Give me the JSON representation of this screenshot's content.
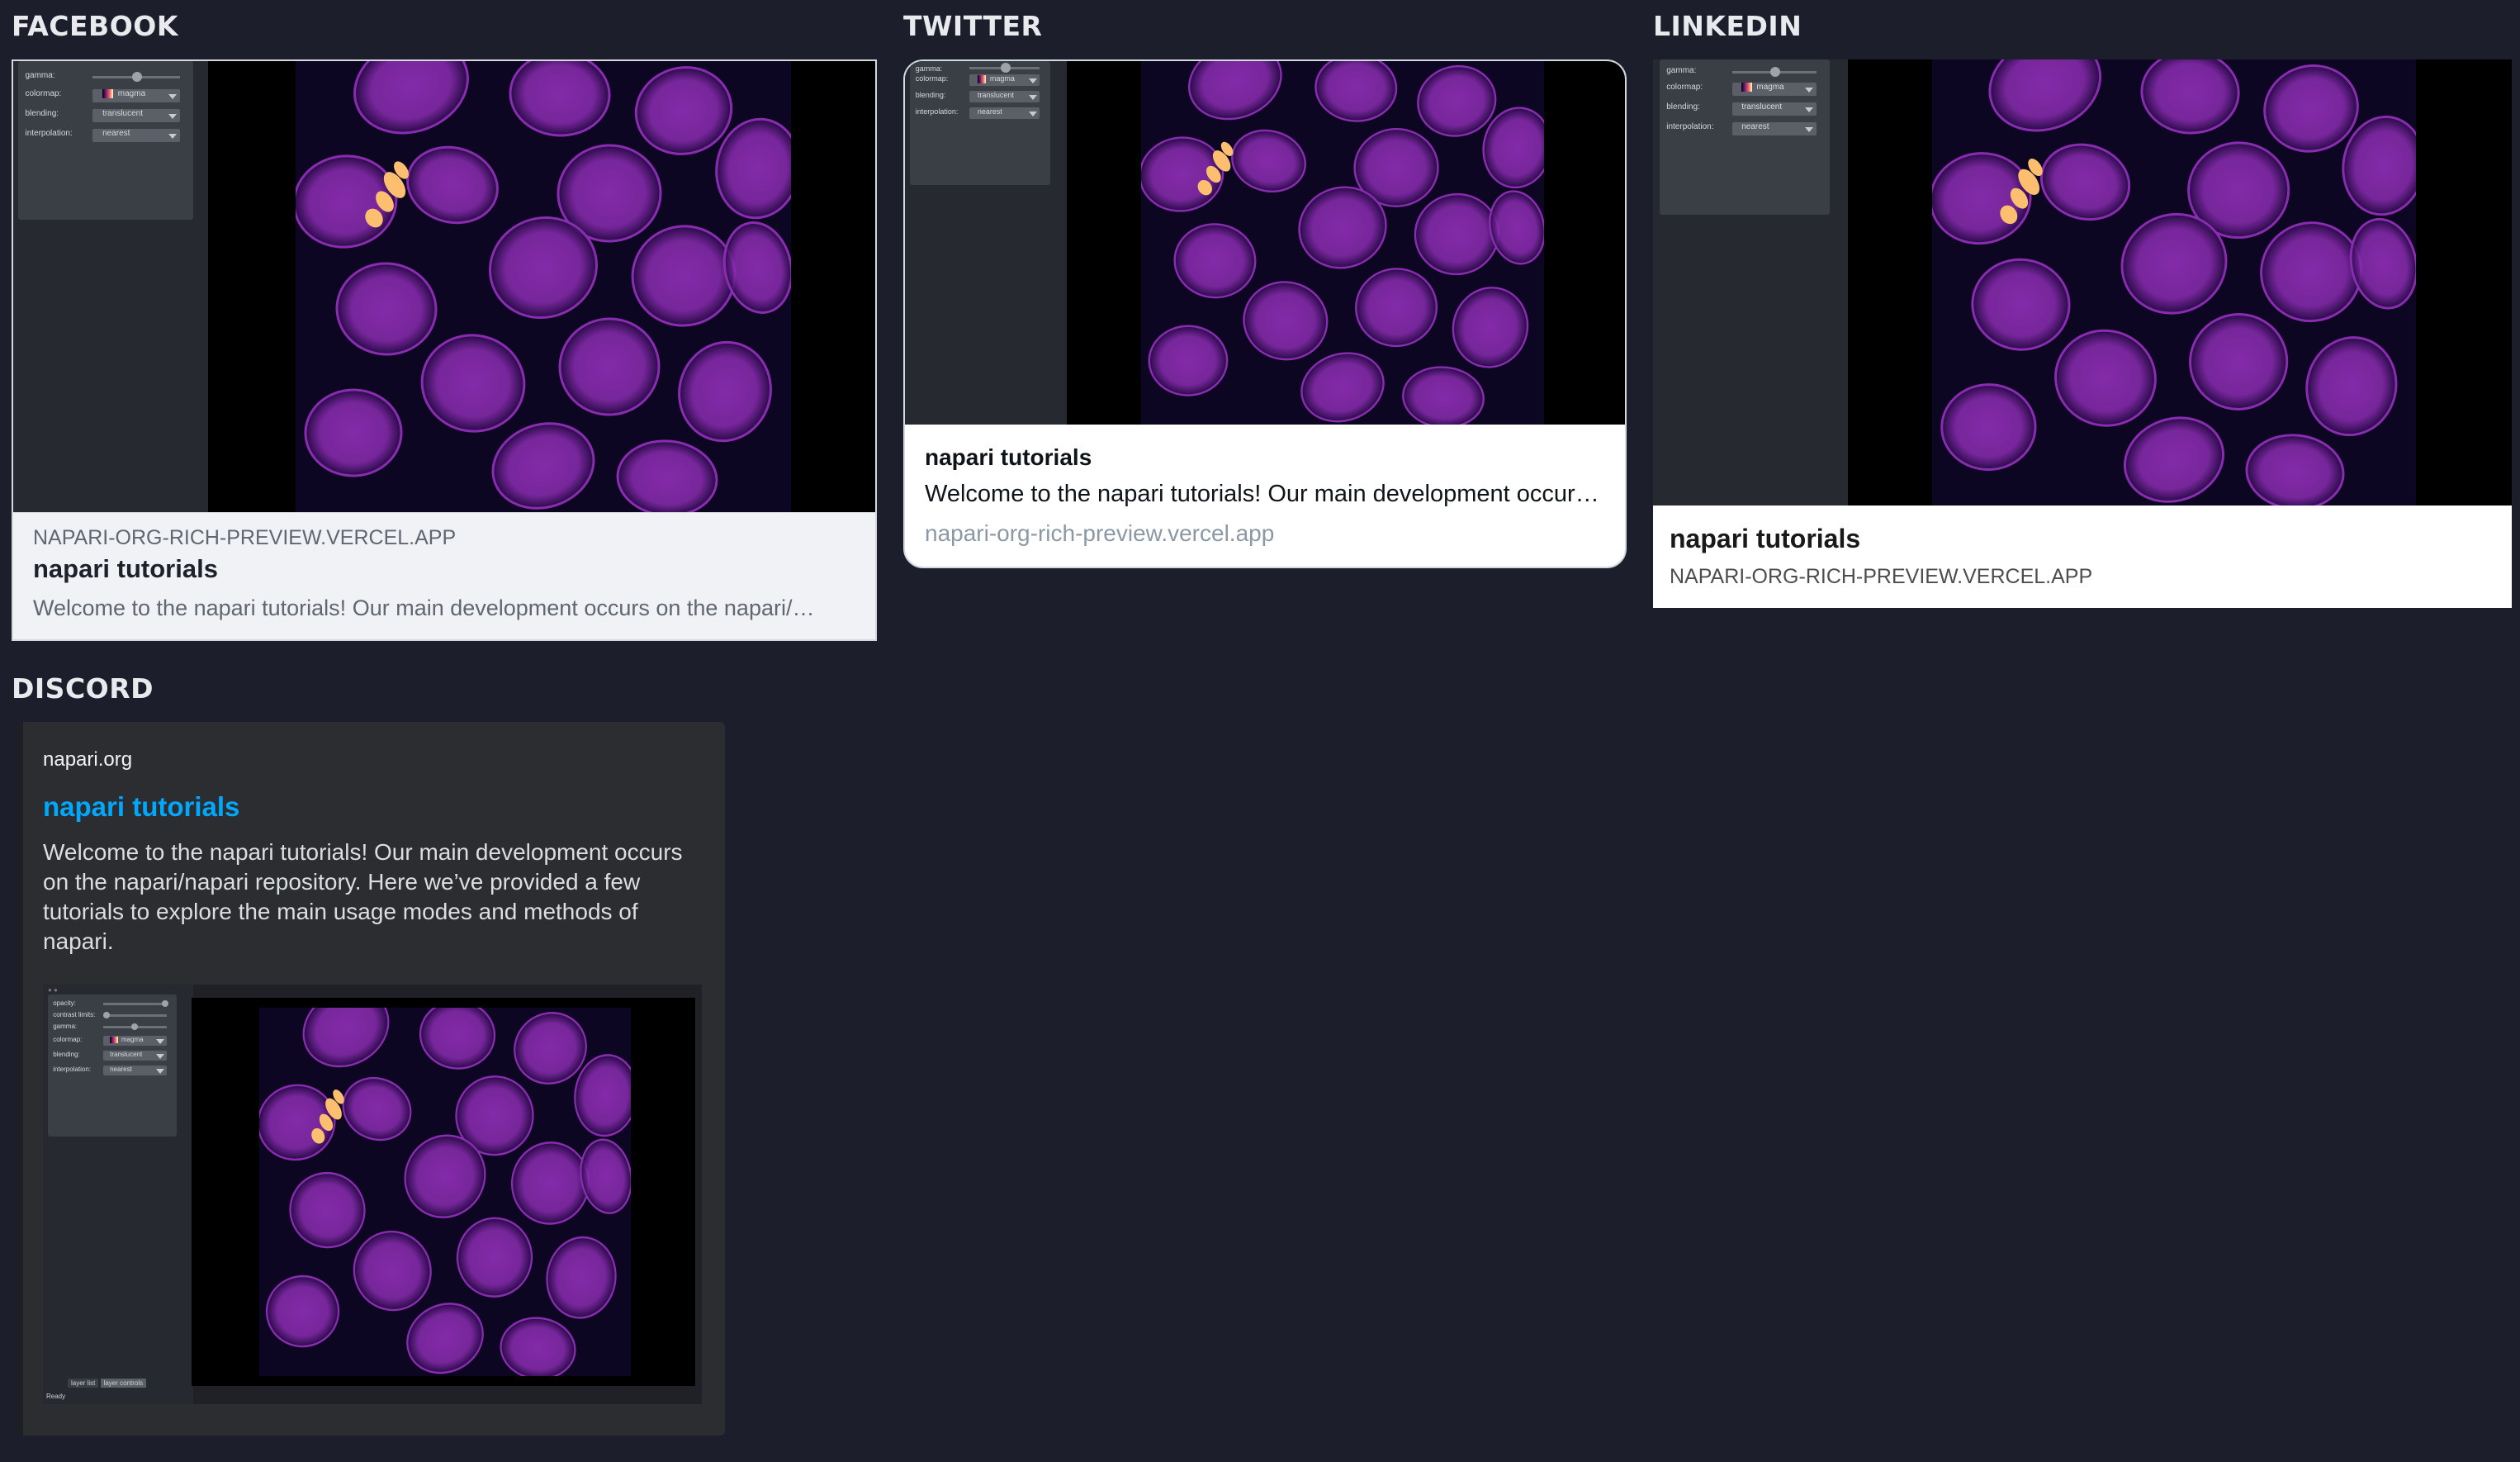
{
  "sections": {
    "facebook": "FACEBOOK",
    "twitter": "TWITTER",
    "linkedin": "LINKEDIN",
    "discord": "DISCORD"
  },
  "preview": {
    "title": "napari tutorials",
    "description_full": "Welcome to the napari tutorials! Our main development occurs on the napari/napari repository. Here we’ve provided a few tutorials to explore the main usage modes and methods of napari.",
    "description_facebook": "Welcome to the napari tutorials! Our main development occurs on the napari/…",
    "description_twitter": "Welcome to the napari tutorials! Our main development occurs …",
    "domain_upper": "NAPARI-ORG-RICH-PREVIEW.VERCEL.APP",
    "domain_lower": "napari-org-rich-preview.vercel.app",
    "discord_provider": "napari.org"
  },
  "napari_ui": {
    "gamma_label": "gamma:",
    "colormap_label": "colormap:",
    "colormap_value": "magma",
    "blending_label": "blending:",
    "blending_value": "translucent",
    "interpolation_label": "interpolation:",
    "interpolation_value": "nearest",
    "opacity_label": "opacity:",
    "contrast_label": "contrast limits:",
    "tab_layer_list": "layer list",
    "tab_layer_controls": "layer controls",
    "status": "Ready"
  },
  "colors": {
    "background": "#1c1f2b",
    "discord_link": "#00a8fc",
    "magma_low": "#2a0a4a",
    "magma_mid": "#8a2cb0",
    "magma_high": "#fcbf6f"
  }
}
